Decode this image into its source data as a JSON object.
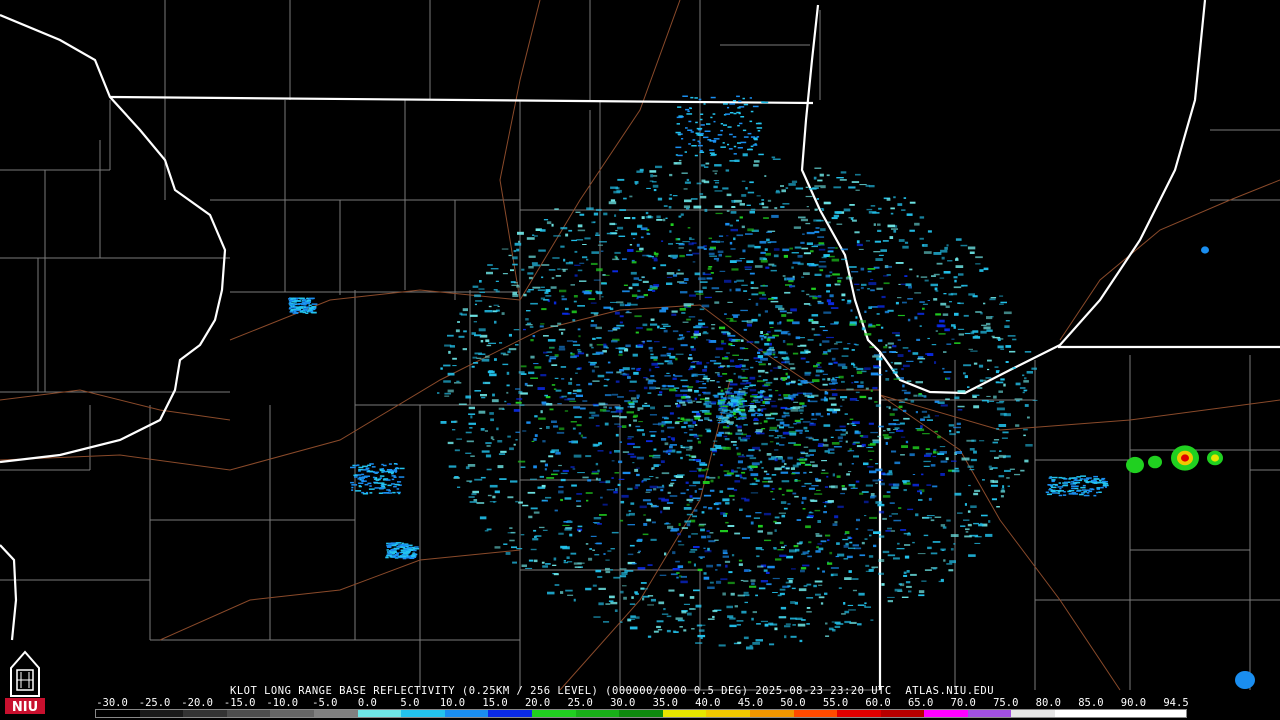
{
  "product": {
    "title": "KLOT LONG RANGE BASE REFLECTIVITY (0.25KM / 256 LEVEL) (000000/0000 0.5 DEG) 2025-08-23 23:20 UTC  ATLAS.NIU.EDU"
  },
  "scale": {
    "labels": [
      "-30.0",
      "-25.0",
      "-20.0",
      "-15.0",
      "-10.0",
      "-5.0",
      "0.0",
      "5.0",
      "10.0",
      "15.0",
      "20.0",
      "25.0",
      "30.0",
      "35.0",
      "40.0",
      "45.0",
      "50.0",
      "55.0",
      "60.0",
      "65.0",
      "70.0",
      "75.0",
      "80.0",
      "85.0",
      "90.0",
      "94.5"
    ],
    "colors": [
      "#000000",
      "#1a1a1a",
      "#333333",
      "#4d4d4d",
      "#666666",
      "#808080",
      "#6ee6e6",
      "#23c4ee",
      "#1a8ef0",
      "#0a2ae6",
      "#20d020",
      "#18b018",
      "#0e8a0e",
      "#e6e600",
      "#f0c800",
      "#f09600",
      "#ff4a00",
      "#e00000",
      "#b80000",
      "#ff00ff",
      "#a050e0",
      "#e6e6e6",
      "#ffffff",
      "#ffffff",
      "#ffffff"
    ],
    "accent_colors": {
      "border": "#ffffff",
      "county": "#7a7a7a",
      "road": "#8a4a2a"
    }
  },
  "logo": {
    "text": "NIU",
    "icon": "university-tower-icon"
  },
  "map": {
    "radar_site": "KLOT"
  }
}
